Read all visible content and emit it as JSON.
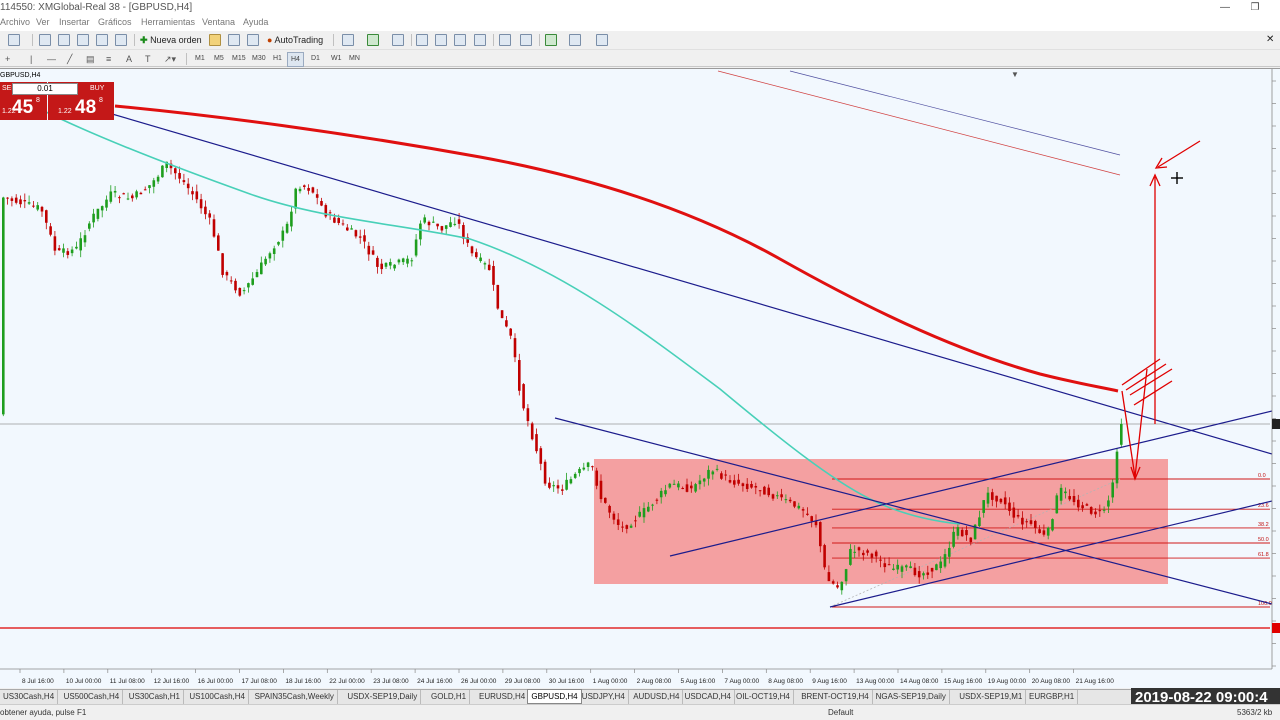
{
  "window": {
    "title": "114550: XMGlobal-Real 38 - [GBPUSD,H4]",
    "minimize": "—",
    "restore": "❐"
  },
  "menu": [
    "Archivo",
    "Ver",
    "Insertar",
    "Gráficos",
    "Herramientas",
    "Ventana",
    "Ayuda"
  ],
  "toolbar": {
    "new_order": "Nueva orden",
    "autotrading": "AutoTrading"
  },
  "timeframes": [
    "M1",
    "M5",
    "M15",
    "M30",
    "H1",
    "H4",
    "D1",
    "W1",
    "MN"
  ],
  "active_timeframe": "H4",
  "chart": {
    "symbol_label": "GBPUSD,H4",
    "one_click": {
      "sell_label": "SELL",
      "buy_label": "BUY",
      "lot": "0.01",
      "sell_prefix": "1.22",
      "sell_main": "45",
      "sell_sup": "8",
      "buy_prefix": "1.22",
      "buy_main": "48",
      "buy_sup": "8"
    },
    "time_labels": [
      "8 Jul 16:00",
      "10 Jul 00:00",
      "11 Jul 08:00",
      "12 Jul 16:00",
      "16 Jul 00:00",
      "17 Jul 08:00",
      "18 Jul 16:00",
      "22 Jul 00:00",
      "23 Jul 08:00",
      "24 Jul 16:00",
      "26 Jul 00:00",
      "29 Jul 08:00",
      "30 Jul 16:00",
      "1 Aug 00:00",
      "2 Aug 08:00",
      "5 Aug 16:00",
      "7 Aug 00:00",
      "8 Aug 08:00",
      "9 Aug 16:00",
      "13 Aug 00:00",
      "14 Aug 08:00",
      "15 Aug 16:00",
      "19 Aug 00:00",
      "20 Aug 08:00",
      "21 Aug 16:00"
    ],
    "fib_levels": [
      "0.0",
      "23.6",
      "38.2",
      "50.0",
      "61.8",
      "100.0"
    ],
    "colors": {
      "bull": "#1e9e1e",
      "bear": "#c00000",
      "ma_red": "#e01010",
      "ma_teal": "#48d0b8",
      "trend": "#1c1c8c",
      "zone": "#f49090",
      "background": "#f2f8fe"
    }
  },
  "tabs": [
    "US30Cash,H4",
    "US500Cash,H4",
    "US30Cash,H1",
    "US100Cash,H4",
    "SPAIN35Cash,Weekly",
    "USDX-SEP19,Daily",
    "GOLD,H1",
    "EURUSD,H4",
    "GBPUSD,H4",
    "USDJPY,H4",
    "AUDUSD,H4",
    "USDCAD,H4",
    "OIL-OCT19,H4",
    "BRENT-OCT19,H4",
    "NGAS-SEP19,Daily",
    "USDX-SEP19,M1",
    "EURGBP,H1"
  ],
  "active_tab": "GBPUSD,H4",
  "clock": "2019-08-22  09:00:4",
  "status": {
    "help": "obtener ayuda, pulse F1",
    "profile": "Default",
    "traffic": "5363/2 kb"
  }
}
